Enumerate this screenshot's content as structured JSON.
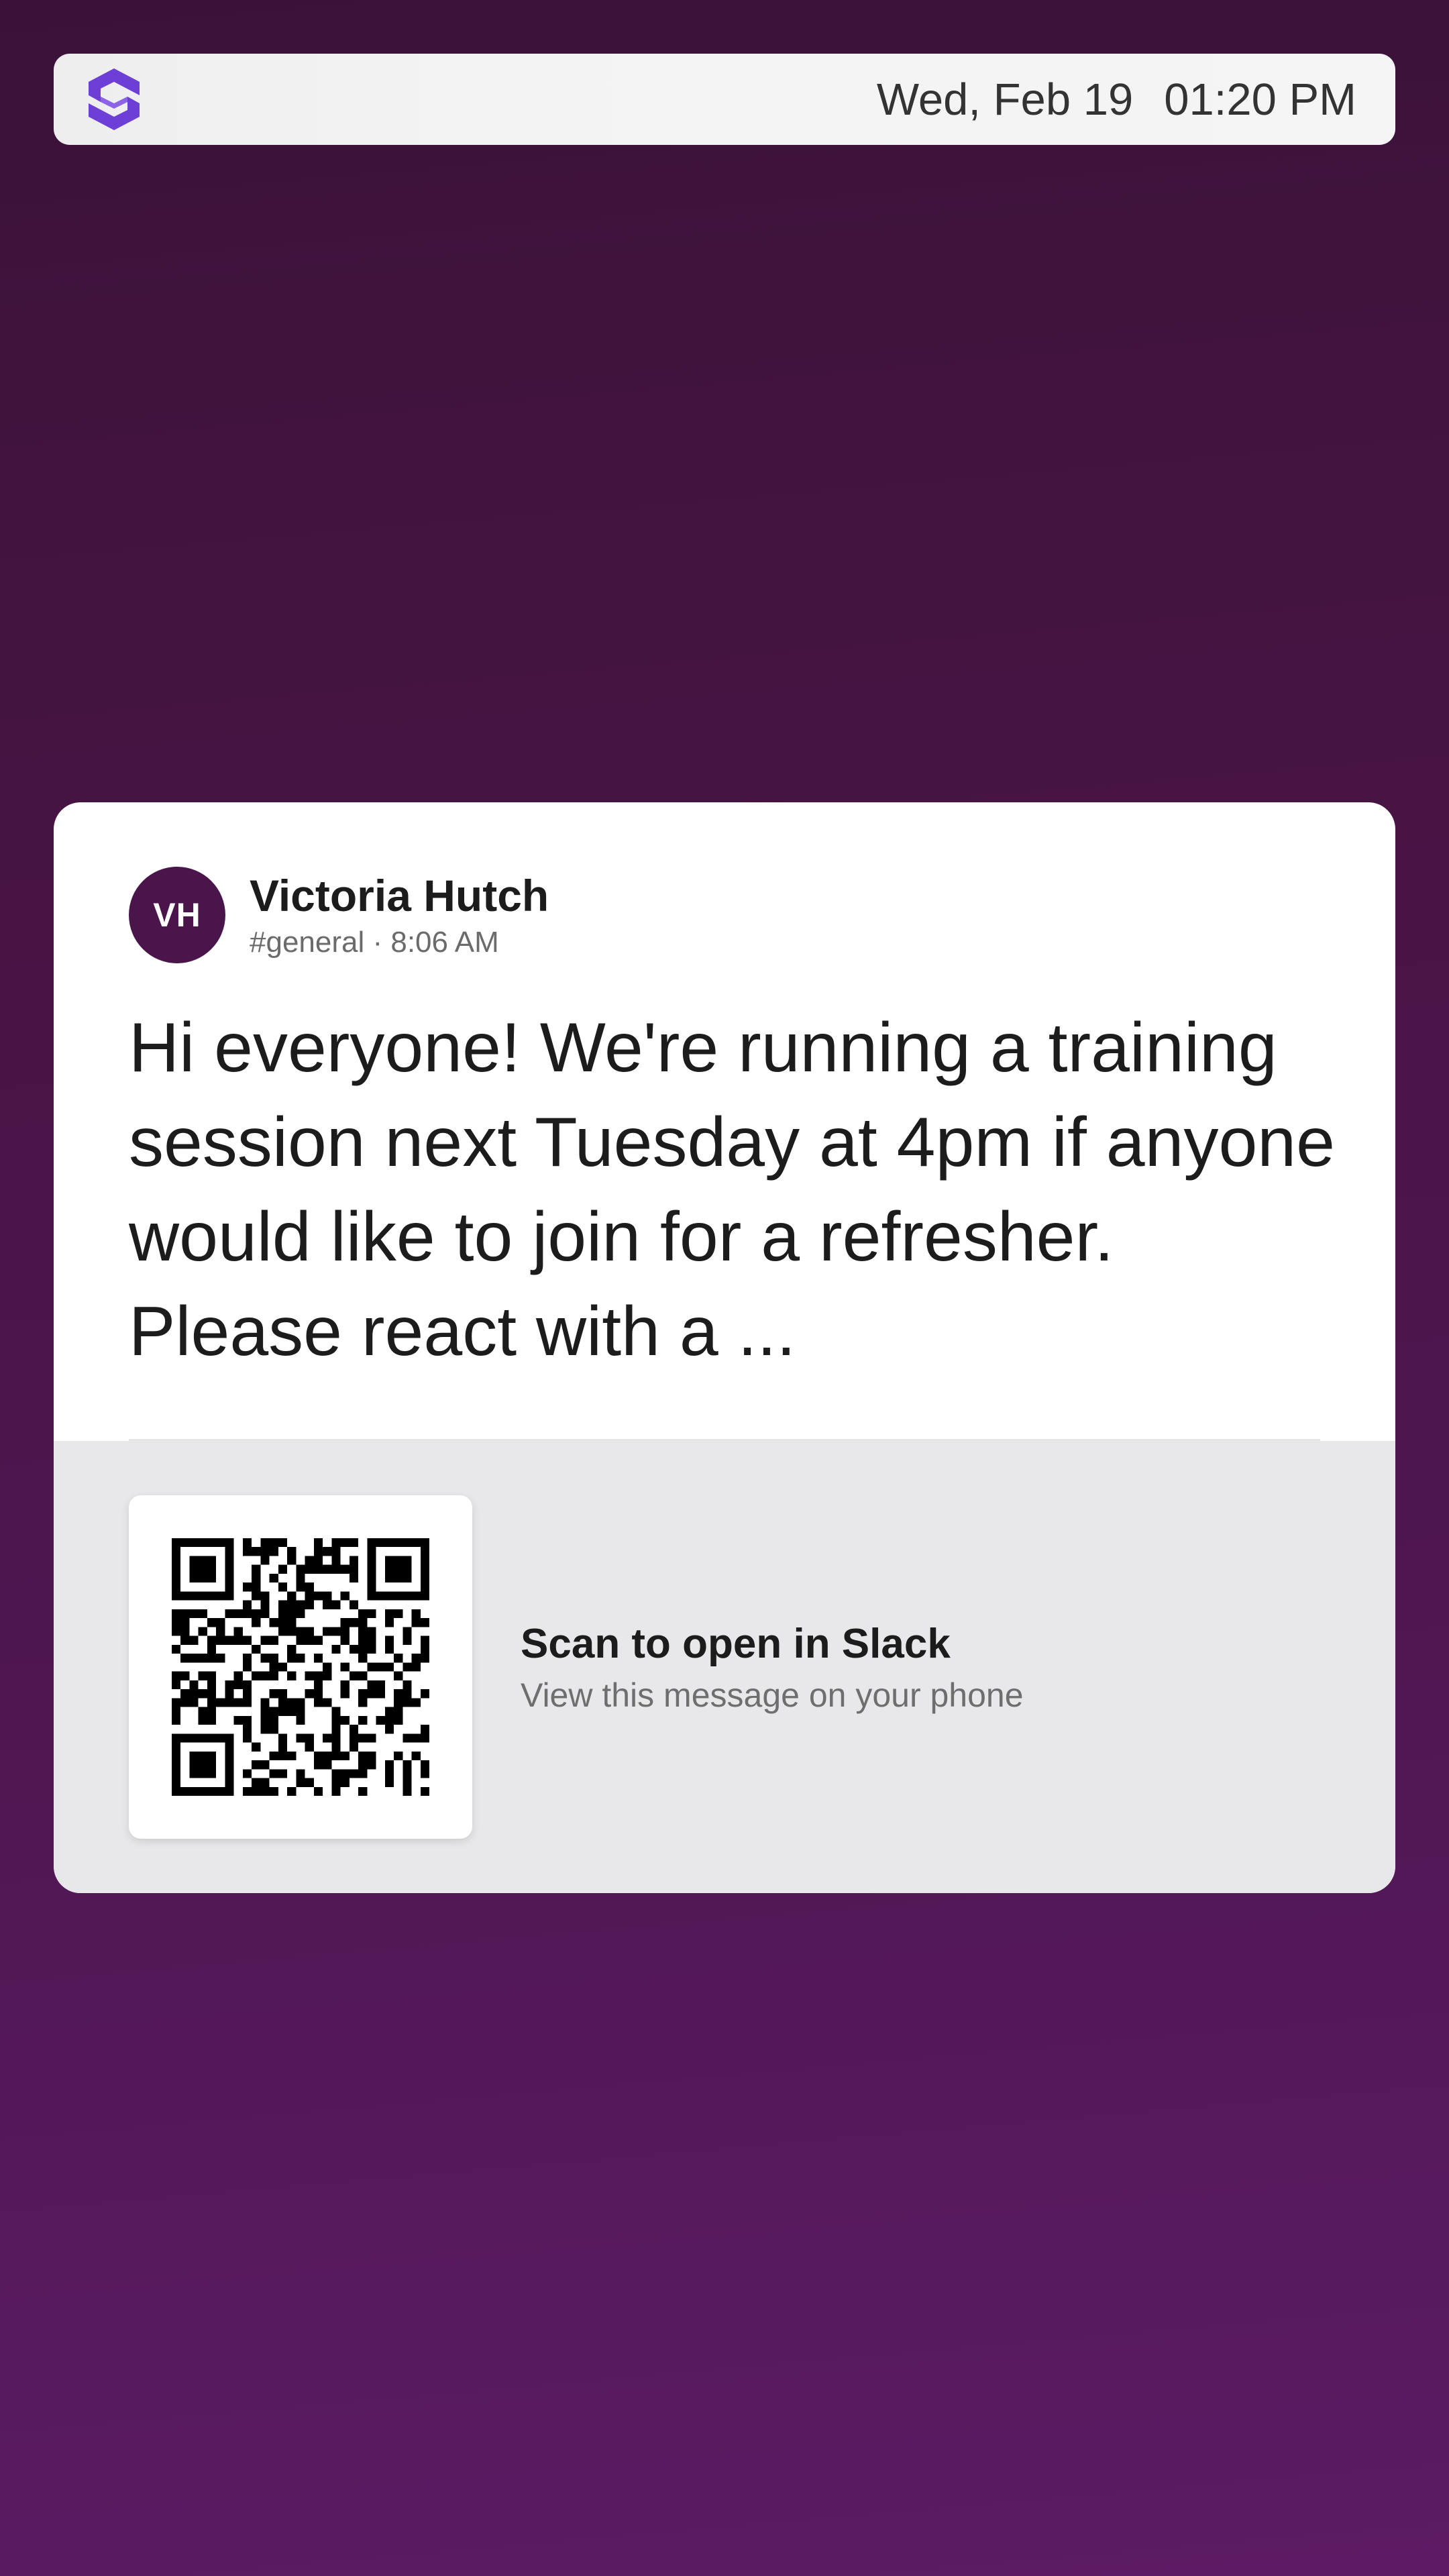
{
  "status_bar": {
    "logo_icon": "app-logo-icon",
    "date": "Wed, Feb 19",
    "time": "01:20 PM"
  },
  "message_card": {
    "avatar_initials": "VH",
    "avatar_color": "#4a154b",
    "author": "Victoria Hutch",
    "channel_and_time": "#general · 8:06 AM",
    "text": "Hi everyone! We're running a training session next Tuesday at 4pm if anyone would like to join for a refresher. Please react with a ..."
  },
  "qr_panel": {
    "qr_icon": "qr-code-icon",
    "title": "Scan to open in Slack",
    "subtitle": "View this message on your phone"
  },
  "colors": {
    "background_top": "#3a1238",
    "background_bottom": "#5c1b64",
    "accent": "#4a154b",
    "logo": "#6d3fd6"
  }
}
